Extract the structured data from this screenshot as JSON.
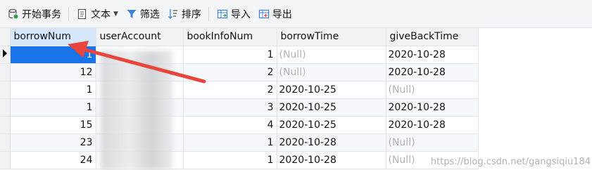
{
  "toolbar": {
    "begin_transaction": "开始事务",
    "text": "文本",
    "filter": "筛选",
    "sort": "排序",
    "import": "导入",
    "export": "导出"
  },
  "columns": [
    "borrowNum",
    "userAccount",
    "bookInfoNum",
    "borrowTime",
    "giveBackTime"
  ],
  "rows": [
    {
      "borrowNum": "1",
      "userAccount": "",
      "bookInfoNum": "1",
      "borrowTime": "(Null)",
      "giveBackTime": "2020-10-28"
    },
    {
      "borrowNum": "12",
      "userAccount": "",
      "bookInfoNum": "2",
      "borrowTime": "(Null)",
      "giveBackTime": "2020-10-28"
    },
    {
      "borrowNum": "1",
      "userAccount": "",
      "bookInfoNum": "2",
      "borrowTime": "2020-10-25",
      "giveBackTime": "(Null)"
    },
    {
      "borrowNum": "1",
      "userAccount": "",
      "bookInfoNum": "3",
      "borrowTime": "2020-10-25",
      "giveBackTime": "2020-10-28"
    },
    {
      "borrowNum": "15",
      "userAccount": "",
      "bookInfoNum": "4",
      "borrowTime": "2020-10-25",
      "giveBackTime": "2020-10-28"
    },
    {
      "borrowNum": "23",
      "userAccount": "",
      "bookInfoNum": "1",
      "borrowTime": "2020-10-28",
      "giveBackTime": "(Null)"
    },
    {
      "borrowNum": "24",
      "userAccount": "",
      "bookInfoNum": "1",
      "borrowTime": "2020-10-28",
      "giveBackTime": "(Null)"
    }
  ],
  "watermark": "https://blog.csdn.net/gangsiqiu184",
  "colors": {
    "accent": "#1a73e8",
    "annotation_arrow": "#e8453c",
    "null_text": "#b3b3b3"
  },
  "icons": [
    "transaction-icon",
    "text-icon",
    "filter-icon",
    "sort-icon",
    "import-icon",
    "export-icon"
  ]
}
